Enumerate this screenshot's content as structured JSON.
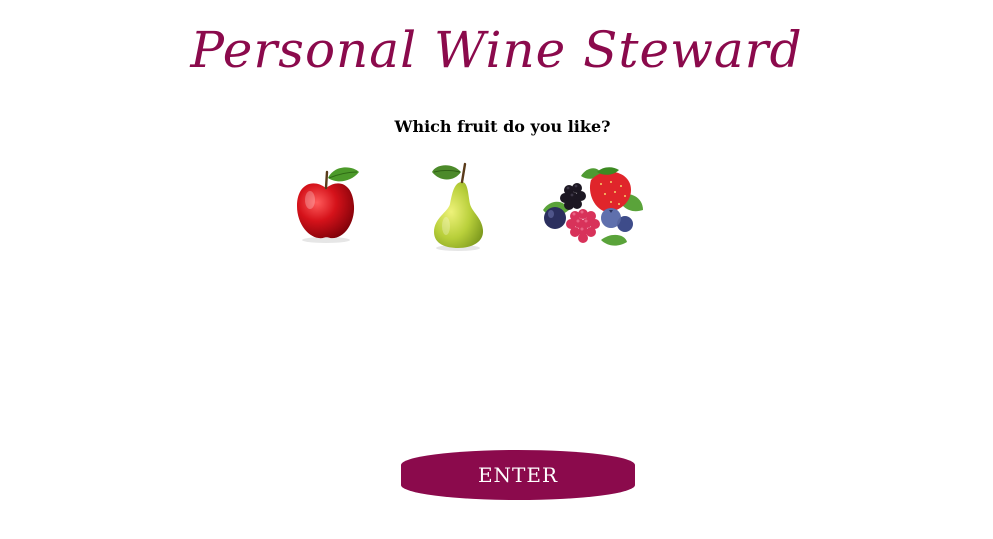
{
  "header": {
    "title": "Personal Wine Steward"
  },
  "question": {
    "text": "Which fruit do you like?"
  },
  "fruits": [
    {
      "name": "apple",
      "icon": "apple-icon"
    },
    {
      "name": "pear",
      "icon": "pear-icon"
    },
    {
      "name": "berries",
      "icon": "berries-icon"
    }
  ],
  "actions": {
    "enter_label": "ENTER"
  },
  "colors": {
    "brand": "#8b0a4c",
    "background": "#ffffff"
  }
}
